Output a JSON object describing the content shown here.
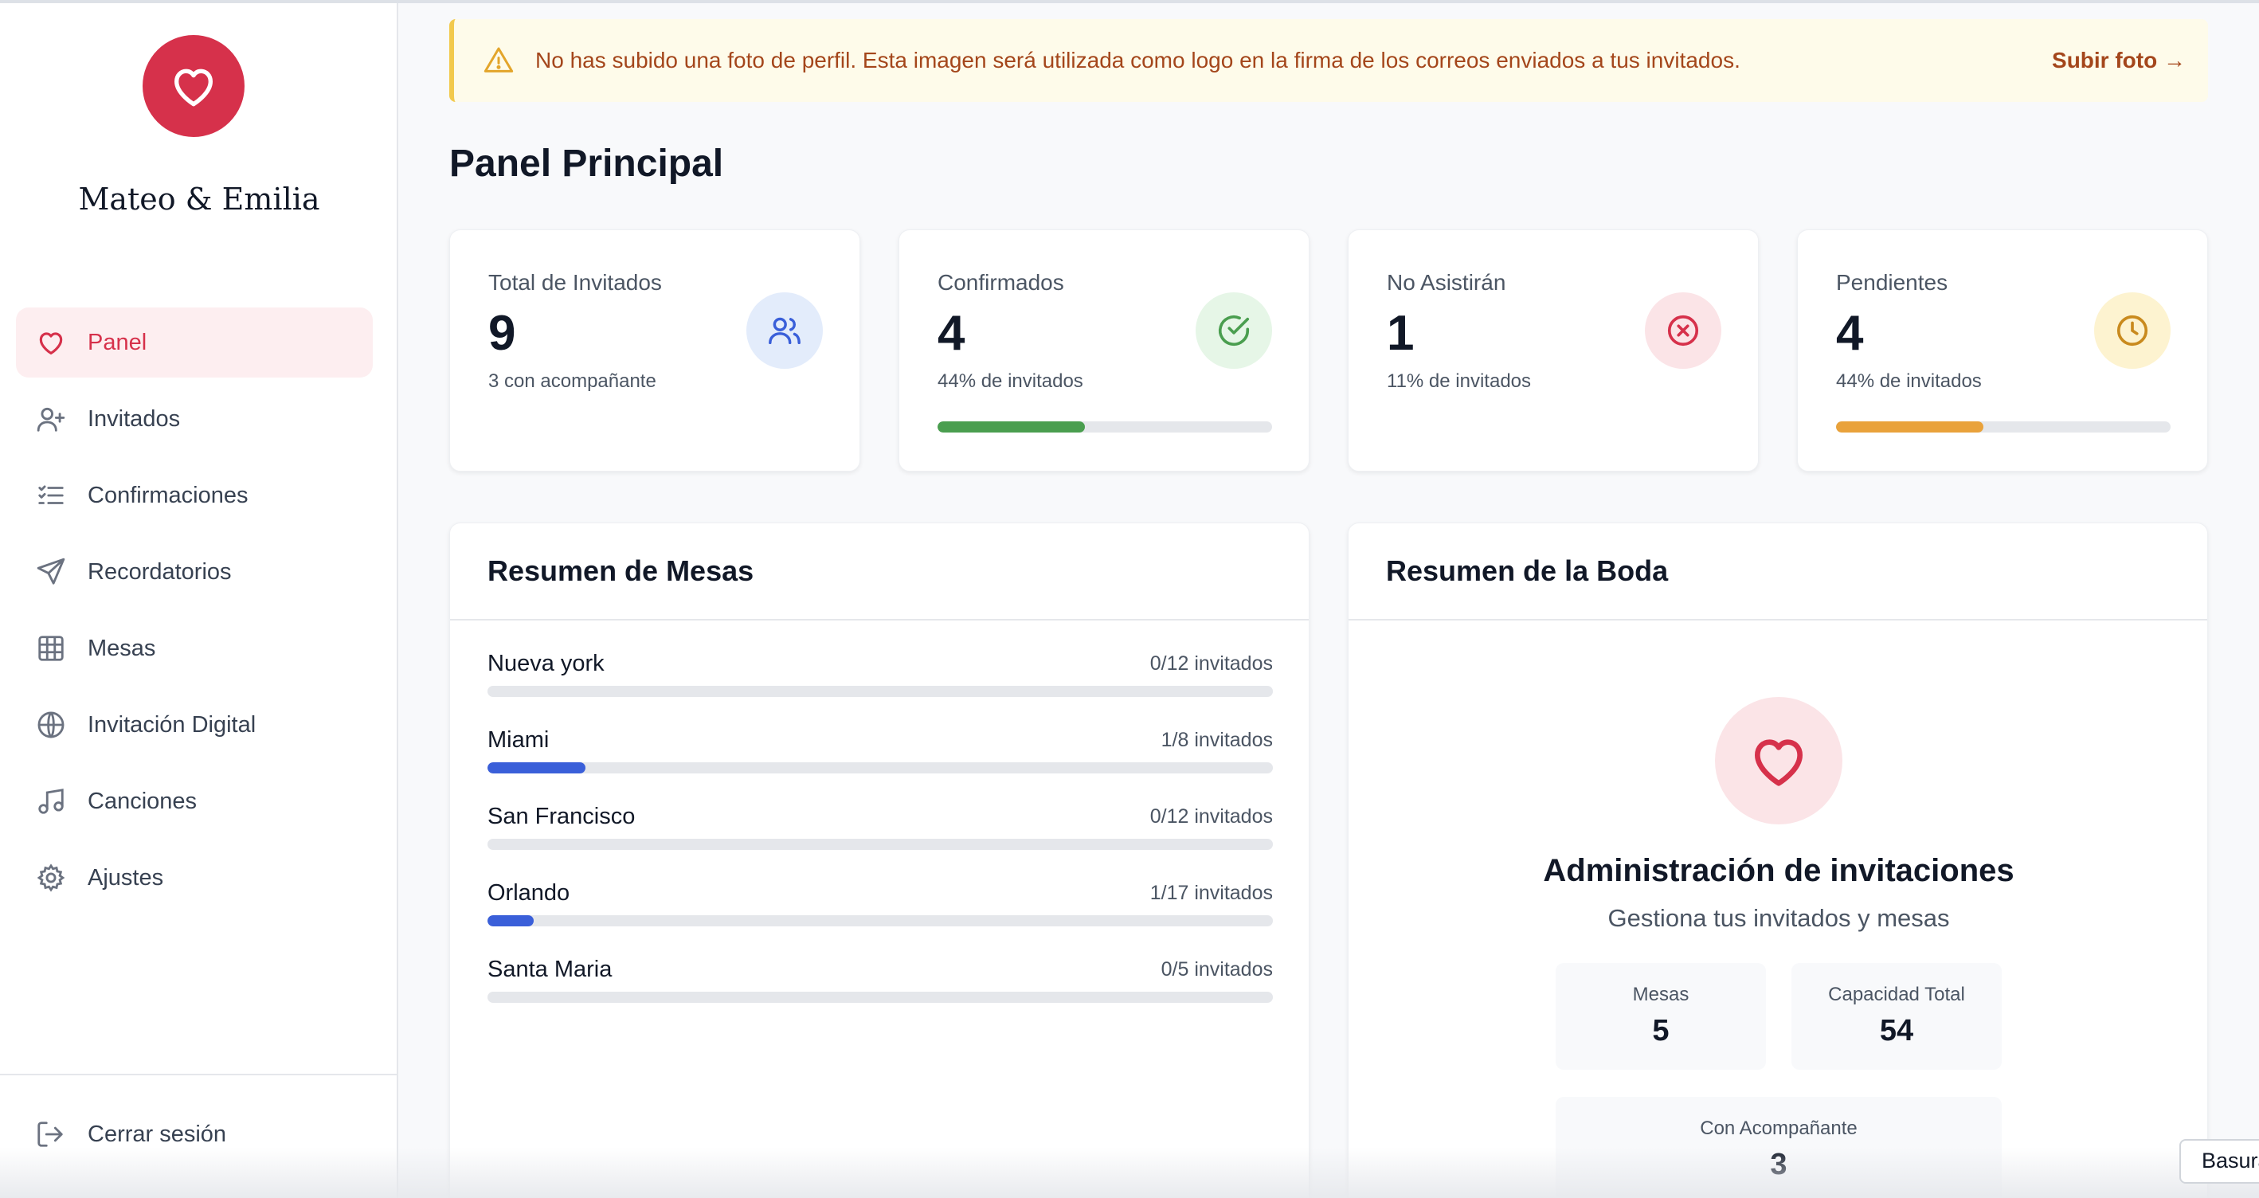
{
  "brand": {
    "couple_name": "Mateo & Emilia",
    "accent": "#d6314b",
    "logo_icon": "heart-icon"
  },
  "sidebar": {
    "items": [
      {
        "label": "Panel",
        "icon": "heart-icon",
        "active": true
      },
      {
        "label": "Invitados",
        "icon": "user-plus-icon",
        "active": false
      },
      {
        "label": "Confirmaciones",
        "icon": "list-checks-icon",
        "active": false
      },
      {
        "label": "Recordatorios",
        "icon": "send-icon",
        "active": false
      },
      {
        "label": "Mesas",
        "icon": "grid-icon",
        "active": false
      },
      {
        "label": "Invitación Digital",
        "icon": "globe-icon",
        "active": false
      },
      {
        "label": "Canciones",
        "icon": "music-icon",
        "active": false
      },
      {
        "label": "Ajustes",
        "icon": "gear-icon",
        "active": false
      }
    ],
    "logout_label": "Cerrar sesión"
  },
  "banner": {
    "text": "No has subido una foto de perfil. Esta imagen será utilizada como logo en la firma de los correos enviados a tus invitados.",
    "link": "Subir foto →",
    "icon": "warning-icon"
  },
  "page_title": "Panel Principal",
  "stats": [
    {
      "label": "Total de Invitados",
      "value": "9",
      "sub": "3 con acompañante",
      "icon": "users-icon",
      "color": "#3a5fd9",
      "bg": "#e3ecfb"
    },
    {
      "label": "Confirmados",
      "value": "4",
      "sub": "44% de invitados",
      "icon": "check-circle-icon",
      "color": "#4a9e4f",
      "bg": "#e6f6e7",
      "progress": 0.44
    },
    {
      "label": "No Asistirán",
      "value": "1",
      "sub": "11% de invitados",
      "icon": "x-circle-icon",
      "color": "#d6314b",
      "bg": "#fbe4e7"
    },
    {
      "label": "Pendientes",
      "value": "4",
      "sub": "44% de invitados",
      "icon": "clock-icon",
      "color": "#e9a23b",
      "bg": "#fdf3d0",
      "progress": 0.44
    }
  ],
  "tables_panel": {
    "title": "Resumen de Mesas",
    "rows": [
      {
        "name": "Nueva york",
        "count": "0/12 invitados",
        "progress": 0.0
      },
      {
        "name": "Miami",
        "count": "1/8 invitados",
        "progress": 0.125
      },
      {
        "name": "San Francisco",
        "count": "0/12 invitados",
        "progress": 0.0
      },
      {
        "name": "Orlando",
        "count": "1/17 invitados",
        "progress": 0.059
      },
      {
        "name": "Santa Maria",
        "count": "0/5 invitados",
        "progress": 0.0
      }
    ]
  },
  "wedding_panel": {
    "title": "Resumen de la Boda",
    "heading": "Administración de invitaciones",
    "subheading": "Gestiona tus invitados y mesas",
    "stats": [
      {
        "label": "Mesas",
        "value": "5"
      },
      {
        "label": "Capacidad Total",
        "value": "54"
      },
      {
        "label": "Con Acompañante",
        "value": "3"
      }
    ]
  },
  "tooltip": "Basura"
}
